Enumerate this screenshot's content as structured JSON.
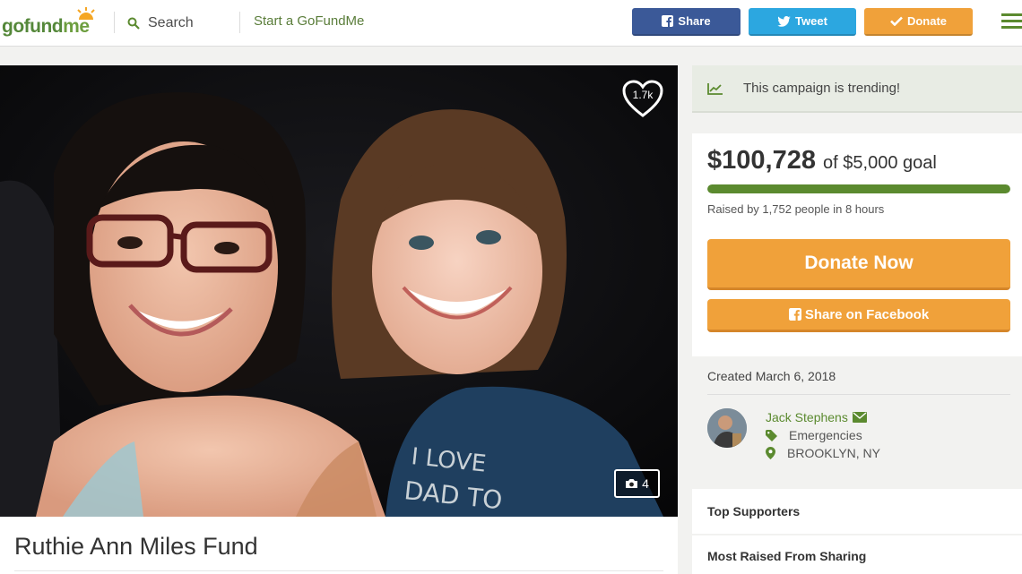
{
  "header": {
    "logo_text_a": "gofund",
    "logo_text_b": "me",
    "search_label": "Search",
    "start_label": "Start a GoFundMe",
    "share_label": "Share",
    "tweet_label": "Tweet",
    "donate_label": "Donate"
  },
  "hero": {
    "likes": "1.7k",
    "photo_count": "4",
    "shirt_text_1": "I LOVE",
    "shirt_text_2": "DAD TO"
  },
  "campaign": {
    "title": "Ruthie Ann Miles Fund"
  },
  "trending": {
    "text": "This campaign is trending!"
  },
  "funding": {
    "raised_amount": "$100,728",
    "goal_text": "of $5,000 goal",
    "progress_fraction": 1.0,
    "raised_by": "Raised by 1,752 people in 8 hours",
    "donate_now_label": "Donate Now",
    "share_facebook_label": "Share on Facebook"
  },
  "details": {
    "created": "Created March 6, 2018",
    "organizer": "Jack Stephens",
    "category": "Emergencies",
    "location": "BROOKLYN, NY"
  },
  "sections": {
    "top_supporters": "Top Supporters",
    "most_raised": "Most Raised From Sharing"
  },
  "colors": {
    "brand_green": "#5b8a2f",
    "facebook_blue": "#3b5998",
    "twitter_blue": "#2ca7e0",
    "donate_orange": "#f0a13a"
  }
}
